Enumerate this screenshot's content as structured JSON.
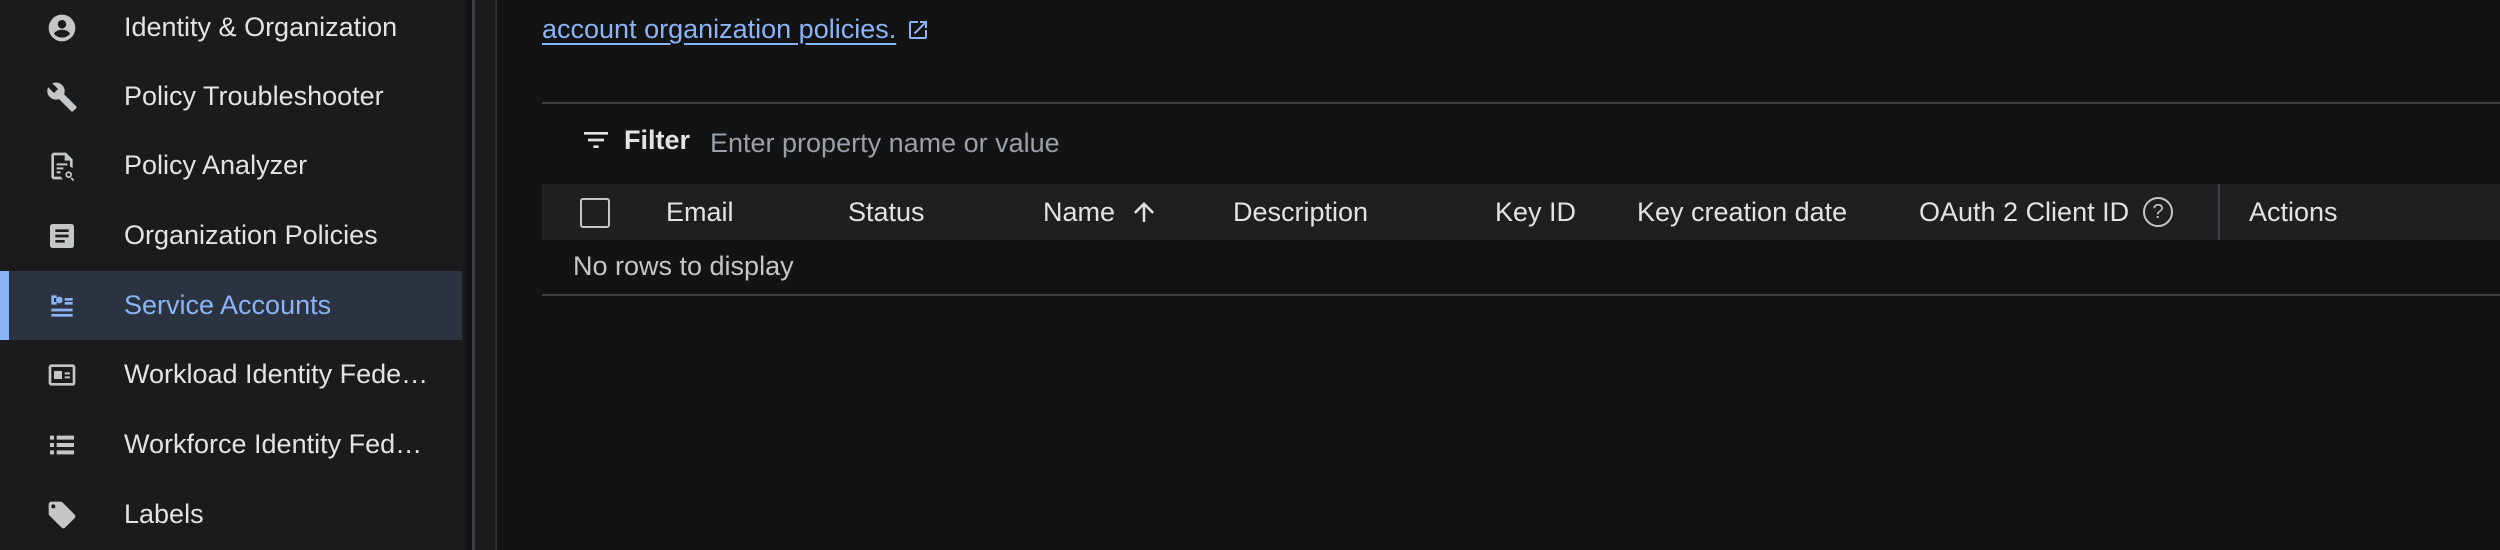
{
  "sidebar": {
    "items": [
      {
        "label": "Identity & Organization",
        "icon": "account-circle-icon",
        "active": false
      },
      {
        "label": "Policy Troubleshooter",
        "icon": "wrench-icon",
        "active": false
      },
      {
        "label": "Policy Analyzer",
        "icon": "document-search-icon",
        "active": false
      },
      {
        "label": "Organization Policies",
        "icon": "article-icon",
        "active": false
      },
      {
        "label": "Service Accounts",
        "icon": "service-account-icon",
        "active": true
      },
      {
        "label": "Workload Identity Fede…",
        "icon": "id-card-icon",
        "active": false
      },
      {
        "label": "Workforce Identity Fed…",
        "icon": "list-icon",
        "active": false
      },
      {
        "label": "Labels",
        "icon": "label-tag-icon",
        "active": false
      }
    ]
  },
  "main": {
    "policy_link": "account organization policies.",
    "filter": {
      "label": "Filter",
      "placeholder": "Enter property name or value"
    },
    "table": {
      "columns": [
        "Email",
        "Status",
        "Name",
        "Description",
        "Key ID",
        "Key creation date",
        "OAuth 2 Client ID",
        "Actions"
      ],
      "sorted_column": "Name",
      "sort_direction": "ascending",
      "empty_message": "No rows to display"
    }
  },
  "colors": {
    "background": "#131314",
    "sidebar": "#1b1b1d",
    "accent": "#8ab4f8",
    "active_item_bg": "#2b3340"
  }
}
